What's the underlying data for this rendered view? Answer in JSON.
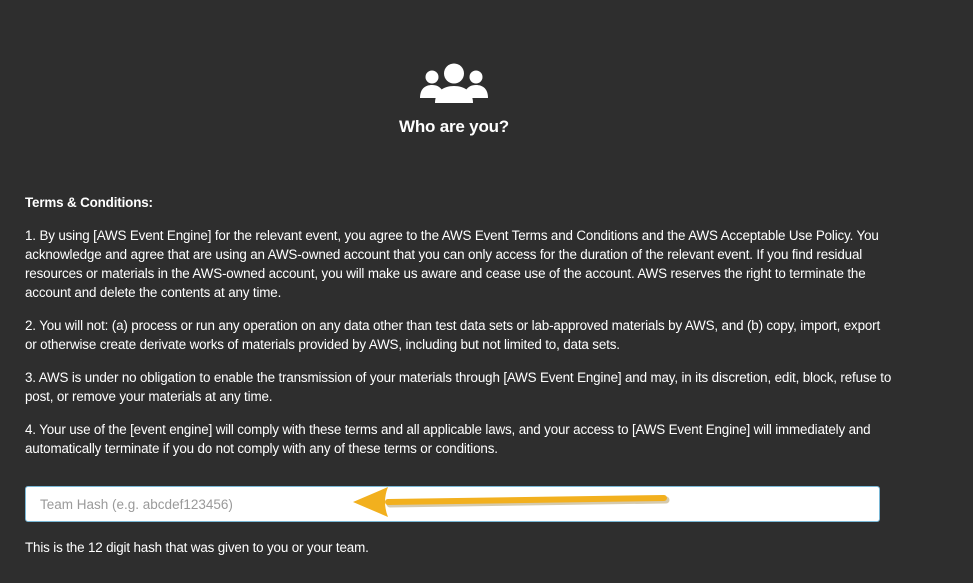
{
  "header": {
    "icon": "users-group-icon",
    "title": "Who are you?"
  },
  "terms": {
    "heading": "Terms & Conditions:",
    "paragraphs": [
      "1. By using [AWS Event Engine] for the relevant event, you agree to the AWS Event Terms and Conditions and the AWS Acceptable Use Policy. You acknowledge and agree that are using an AWS-owned account that you can only access for the duration of the relevant event. If you find residual resources or materials in the AWS-owned account, you will make us aware and cease use of the account. AWS reserves the right to terminate the account and delete the contents at any time.",
      "2. You will not: (a) process or run any operation on any data other than test data sets or lab-approved materials by AWS, and (b) copy, import, export or otherwise create derivate works of materials provided by AWS, including but not limited to, data sets.",
      "3. AWS is under no obligation to enable the transmission of your materials through [AWS Event Engine] and may, in its discretion, edit, block, refuse to post, or remove your materials at any time.",
      "4. Your use of the [event engine] will comply with these terms and all applicable laws, and your access to [AWS Event Engine] will immediately and automatically terminate if you do not comply with any of these terms or conditions."
    ]
  },
  "team_hash": {
    "value": "",
    "placeholder": "Team Hash (e.g. abcdef123456)",
    "hint": "This is the 12 digit hash that was given to you or your team."
  },
  "annotation": {
    "icon": "arrow-left-icon",
    "color": "#f2b01e"
  },
  "colors": {
    "background": "#2e2e2e",
    "text": "#ffffff",
    "field_border": "#7ab8d6"
  }
}
